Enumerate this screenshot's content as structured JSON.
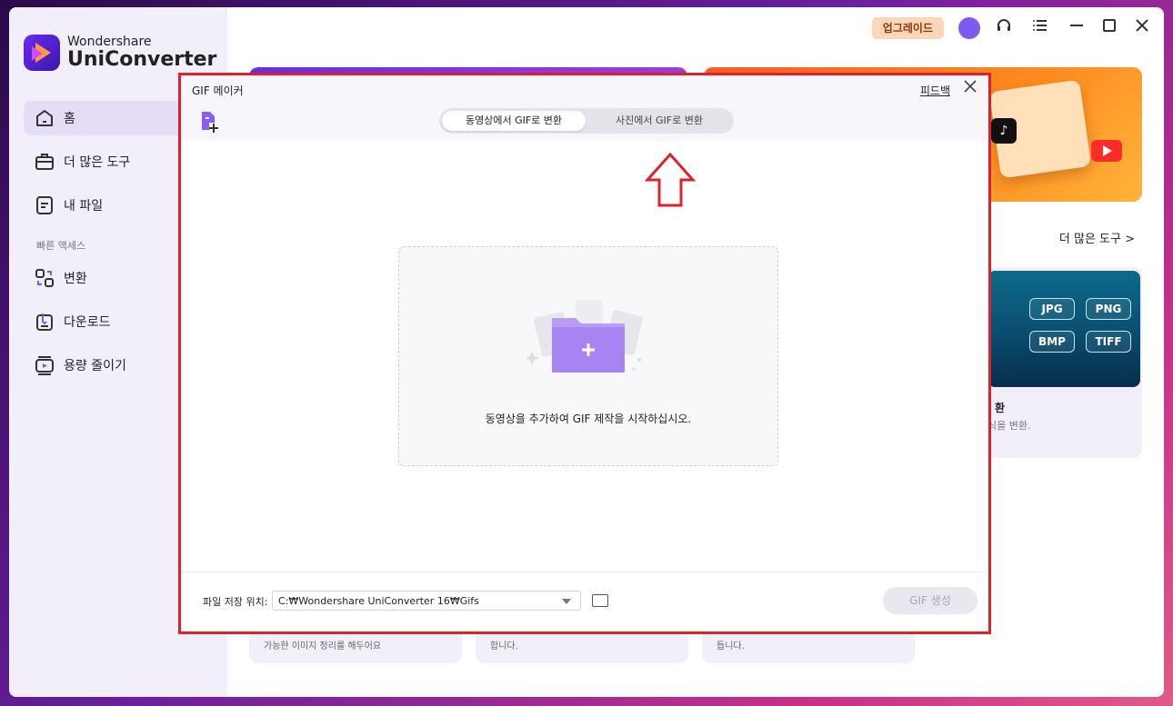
{
  "app": {
    "brand": "Wondershare",
    "name": "UniConverter"
  },
  "sidebar": {
    "items": [
      {
        "label": "홈",
        "icon": "home-icon",
        "active": true
      },
      {
        "label": "더 많은 도구",
        "icon": "toolbox-icon",
        "active": false
      },
      {
        "label": "내 파일",
        "icon": "file-icon",
        "active": false
      }
    ],
    "section_label": "빠른 액세스",
    "quick": [
      {
        "label": "변환",
        "icon": "convert-icon"
      },
      {
        "label": "다운로드",
        "icon": "download-icon"
      },
      {
        "label": "용량 줄이기",
        "icon": "compress-icon"
      }
    ]
  },
  "topbar": {
    "upgrade_label": "업그레이드",
    "icons": [
      "avatar",
      "headset-icon",
      "menu-icon",
      "minimize-icon",
      "maximize-icon",
      "close-icon"
    ]
  },
  "main": {
    "more_tools": "더 많은 도구 >",
    "image_card": {
      "formats": [
        "JPG",
        "PNG",
        "BMP",
        "TIFF"
      ],
      "title_fragment": "환",
      "desc_fragment": "식을 변환."
    },
    "bottom_cards": [
      {
        "text_fragment": "가능한 이미지 정리를 해두어요"
      },
      {
        "text_fragment": "합니다."
      },
      {
        "text_fragment": "듭니다."
      }
    ]
  },
  "dialog": {
    "title": "GIF 메이커",
    "feedback": "피드백",
    "tabs": [
      {
        "label": "동영상에서 GIF로 변환",
        "active": true
      },
      {
        "label": "사진에서 GIF로 변환",
        "active": false
      }
    ],
    "drop_text": "동영상을 추가하여 GIF 제작을 시작하십시오.",
    "save_label": "파일 저장 위치:",
    "save_path": "C:₩Wondershare UniConverter 16₩Gifs",
    "generate_label": "GIF 생성"
  },
  "colors": {
    "accent": "#7c5cf0",
    "highlight_border": "#e0202a",
    "upgrade_bg": "#ffd6b8"
  }
}
